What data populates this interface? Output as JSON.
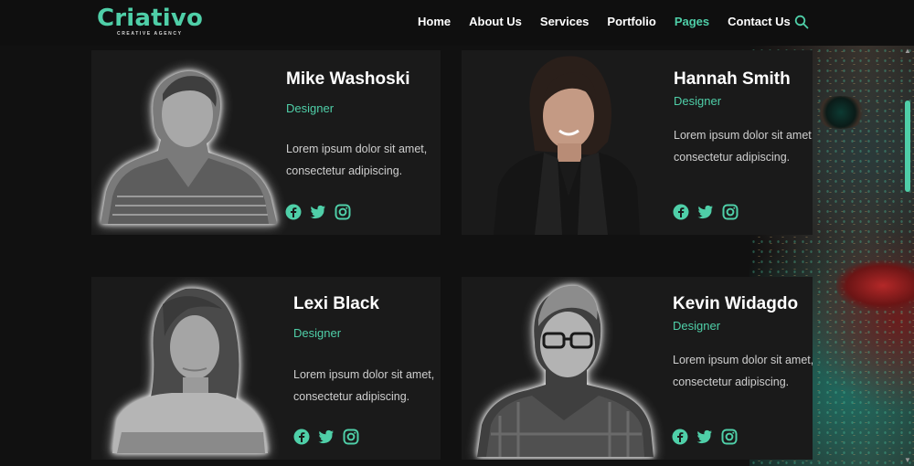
{
  "brand": {
    "name": "Criativo",
    "tagline": "CREATIVE AGENCY",
    "accent": "#4fcfa8"
  },
  "nav": {
    "items": [
      {
        "label": "Home",
        "active": false
      },
      {
        "label": "About Us",
        "active": false
      },
      {
        "label": "Services",
        "active": false
      },
      {
        "label": "Portfolio",
        "active": false
      },
      {
        "label": "Pages",
        "active": true
      },
      {
        "label": "Contact Us",
        "active": false
      }
    ],
    "search_icon": "search-icon"
  },
  "team": [
    {
      "name": "Mike Washoski",
      "role": "Designer",
      "description": "Lorem ipsum dolor sit amet, consectetur adipiscing.",
      "social": [
        "facebook-icon",
        "twitter-icon",
        "instagram-icon"
      ]
    },
    {
      "name": "Hannah Smith",
      "role": "Designer",
      "description": "Lorem ipsum dolor sit amet, consectetur adipiscing.",
      "social": [
        "facebook-icon",
        "twitter-icon",
        "instagram-icon"
      ]
    },
    {
      "name": "Lexi Black",
      "role": "Designer",
      "description": "Lorem ipsum dolor sit amet, consectetur adipiscing.",
      "social": [
        "facebook-icon",
        "twitter-icon",
        "instagram-icon"
      ]
    },
    {
      "name": "Kevin Widagdo",
      "role": "Designer",
      "description": "Lorem ipsum dolor sit amet, consectetur adipiscing.",
      "social": [
        "facebook-icon",
        "twitter-icon",
        "instagram-icon"
      ]
    }
  ]
}
